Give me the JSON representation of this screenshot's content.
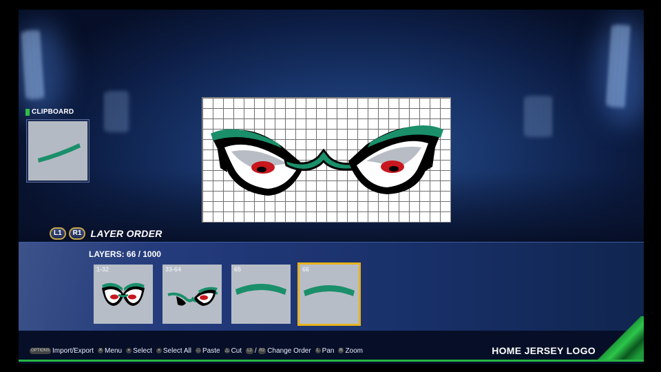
{
  "clipboard": {
    "label": "CLIPBOARD"
  },
  "layer_order": {
    "l1": "L1",
    "r1": "R1",
    "title": "LAYER ORDER"
  },
  "layers": {
    "count_label": "LAYERS: 66 / 1000",
    "thumbs": [
      {
        "label": "1-32"
      },
      {
        "label": "33-64"
      },
      {
        "label": "65"
      },
      {
        "label": "66",
        "selected": true
      }
    ]
  },
  "hints": [
    {
      "glyph": "OPTIONS",
      "label": "Import/Export"
    },
    {
      "glyph": "✕",
      "label": "Menu"
    },
    {
      "glyph": "▪",
      "label": "Select"
    },
    {
      "glyph": "▪",
      "label": "Select All"
    },
    {
      "glyph": "□",
      "label": "Paste"
    },
    {
      "glyph": "△",
      "label": "Cut"
    },
    {
      "glyph": "L2",
      "label": "/",
      "glyph2": "R2",
      "label2": "Change Order"
    },
    {
      "glyph": "L",
      "label": "Pan"
    },
    {
      "glyph": "R",
      "label": "Zoom"
    }
  ],
  "footer": {
    "title": "HOME JERSEY LOGO"
  },
  "colors": {
    "accent_green": "#1a8f6a",
    "selection": "#e8b21d",
    "pupil": "#c8171e"
  }
}
